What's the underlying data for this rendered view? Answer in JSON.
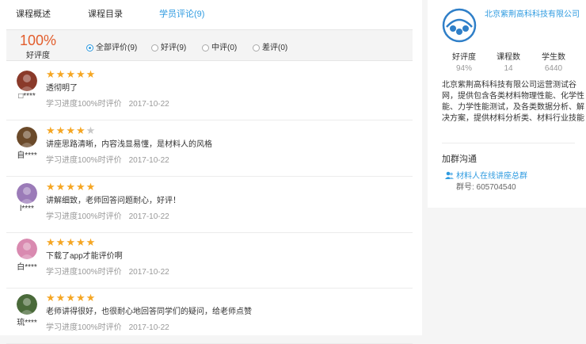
{
  "tabs": [
    {
      "label": "课程概述",
      "active": false
    },
    {
      "label": "课程目录",
      "active": false
    },
    {
      "label": "学员评论(9)",
      "active": true
    }
  ],
  "summary": {
    "percent": "100%",
    "label": "好评度"
  },
  "filters": [
    {
      "label": "全部评价(9)",
      "selected": true
    },
    {
      "label": "好评(9)",
      "selected": false
    },
    {
      "label": "中评(0)",
      "selected": false
    },
    {
      "label": "差评(0)",
      "selected": false
    }
  ],
  "reviews": [
    {
      "user": "□****",
      "rating": 5,
      "comment": "透彻明了",
      "progress": "学习进度100%时评价",
      "date": "2017-10-22",
      "avatar_color": "#8a3a2a"
    },
    {
      "user": "自****",
      "rating": 4,
      "comment": "讲座思路清晰，内容浅显易懂，是材料人的风格",
      "progress": "学习进度100%时评价",
      "date": "2017-10-22",
      "avatar_color": "#6b4a2a"
    },
    {
      "user": "l****",
      "rating": 5,
      "comment": "讲解细致，老师回答问题耐心，好评！",
      "progress": "学习进度100%时评价",
      "date": "2017-10-22",
      "avatar_color": "#9b7bb8"
    },
    {
      "user": "白****",
      "rating": 5,
      "comment": "下载了app才能评价啊",
      "progress": "学习进度100%时评价",
      "date": "2017-10-22",
      "avatar_color": "#d98ab0"
    },
    {
      "user": "琉****",
      "rating": 5,
      "comment": "老师讲得很好，也很耐心地回答同学们的疑问，给老师点赞",
      "progress": "学习进度100%时评价",
      "date": "2017-10-22",
      "avatar_color": "#4a6a3a"
    }
  ],
  "sidebar": {
    "company": "北京紫荆高科科技有限公司",
    "stats": [
      {
        "label": "好评度",
        "value": "94%"
      },
      {
        "label": "课程数",
        "value": "14"
      },
      {
        "label": "学生数",
        "value": "6440"
      }
    ],
    "description": "北京紫荆高科科技有限公司运营测试谷网，提供包含各类材料物理性能、化学性能、力学性能测试，及各类数据分析、解决方案，提供材料分析类、材料行业技能培训、讲座",
    "group_title": "加群沟通",
    "group_name": "材料人在线讲座总群",
    "group_no": "群号: 605704540",
    "accent": "#2f9be0"
  }
}
